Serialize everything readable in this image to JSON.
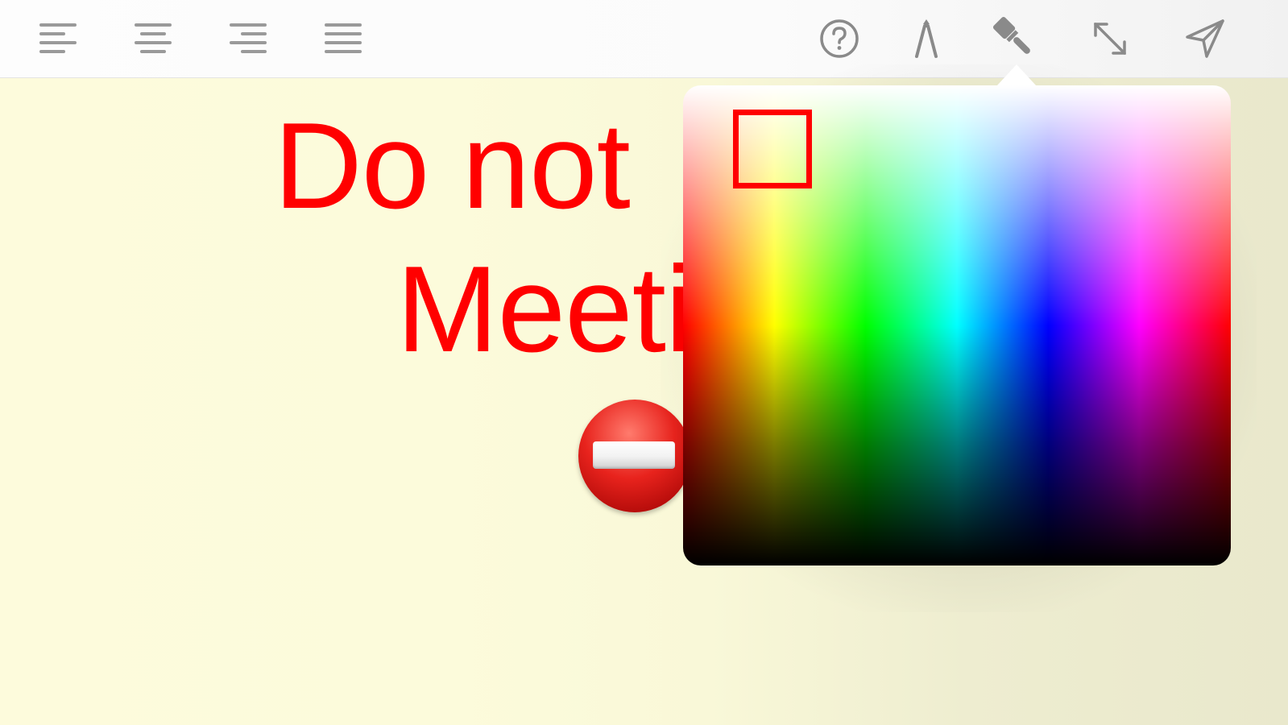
{
  "toolbar": {
    "left_tools": [
      {
        "name": "align-left-icon"
      },
      {
        "name": "align-center-icon"
      },
      {
        "name": "align-right-icon"
      },
      {
        "name": "align-justify-icon"
      }
    ],
    "right_tools": [
      {
        "name": "help-icon"
      },
      {
        "name": "pen-icon"
      },
      {
        "name": "paint-brush-icon"
      },
      {
        "name": "expand-icon"
      },
      {
        "name": "send-icon"
      }
    ],
    "icon_color": "#8a8a8a"
  },
  "note": {
    "line1": "Do not",
    "line2": "Meeti",
    "emoji_name": "no-entry-icon",
    "text_color": "#ff0000",
    "background_color": "#fcfbdf"
  },
  "color_picker": {
    "selected_color": "#ff0000",
    "spectrum": [
      "#ff0000",
      "#ffff00",
      "#00ff00",
      "#00ffff",
      "#0000ff",
      "#ff00ff",
      "#ff0000"
    ]
  }
}
